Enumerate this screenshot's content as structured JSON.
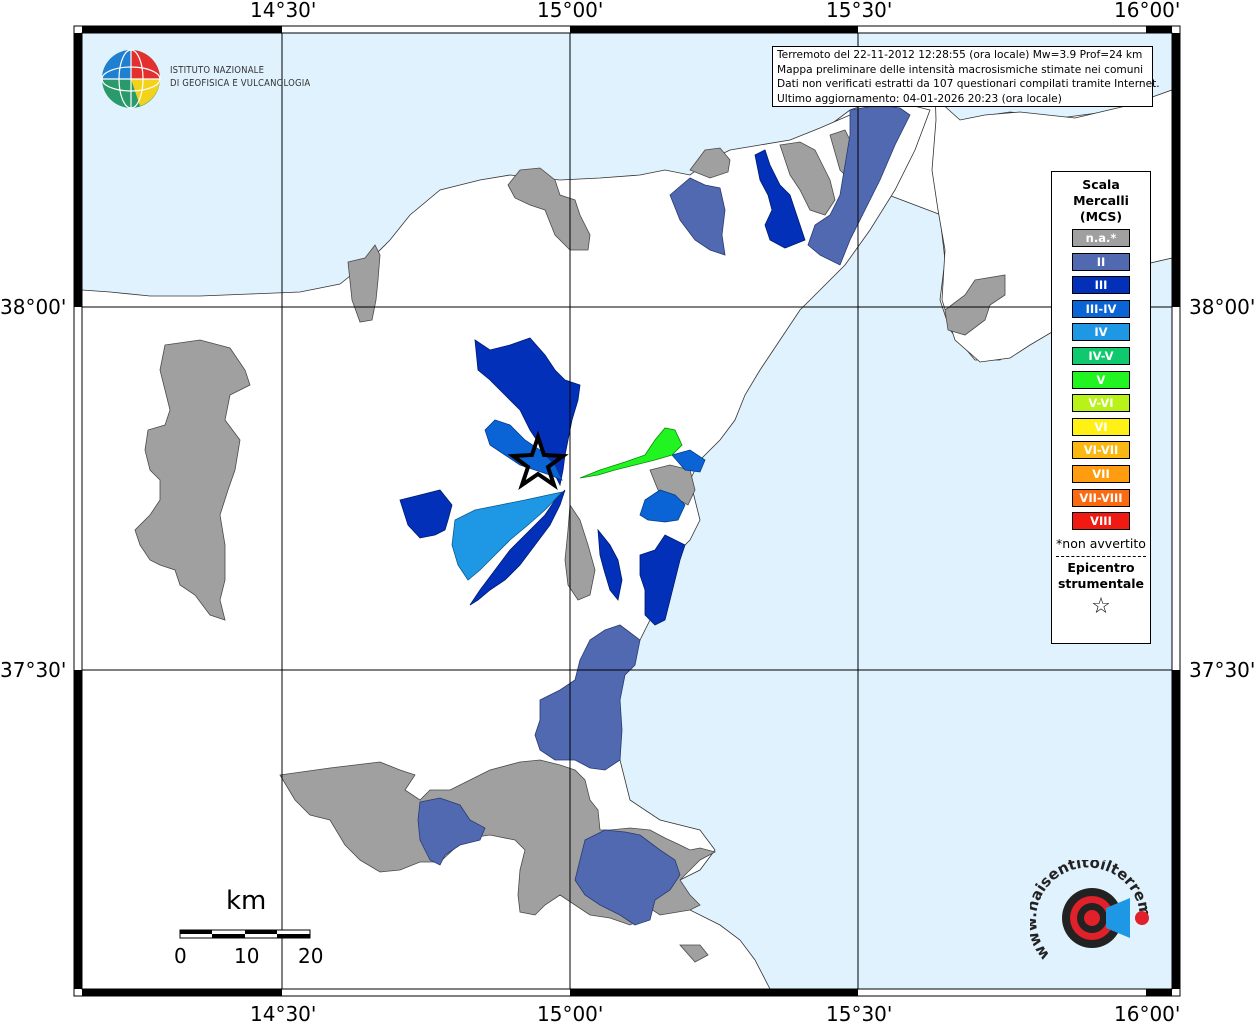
{
  "map": {
    "lon_labels": [
      "14°30'",
      "15°00'",
      "15°30'",
      "16°00'"
    ],
    "lat_labels": [
      "38°00'",
      "37°30'"
    ]
  },
  "header": {
    "lines": [
      "Terremoto del 22-11-2012 12:28:55 (ora locale) Mw=3.9 Prof=24 km",
      "Mappa preliminare delle intensità macrosismiche stimate nei comuni",
      "Dati non verificati estratti da 107 questionari compilati tramite Internet.",
      "Ultimo aggiornamento: 04-01-2026 20:23 (ora locale)"
    ]
  },
  "logo": {
    "line1": "ISTITUTO NAZIONALE",
    "line2": "DI GEOFISICA E VULCANOLOGIA"
  },
  "legend": {
    "title": "Scala\nMercalli\n(MCS)",
    "items": [
      {
        "label": "n.a.*",
        "color": "#a0a0a0"
      },
      {
        "label": "II",
        "color": "#5069b1"
      },
      {
        "label": "III",
        "color": "#0230b8"
      },
      {
        "label": "III-IV",
        "color": "#0a64d6"
      },
      {
        "label": "IV",
        "color": "#1e98e4"
      },
      {
        "label": "IV-V",
        "color": "#10c86e"
      },
      {
        "label": "V",
        "color": "#22f422"
      },
      {
        "label": "V-VI",
        "color": "#b8f218"
      },
      {
        "label": "VI",
        "color": "#fff016"
      },
      {
        "label": "VI-VII",
        "color": "#fcb812"
      },
      {
        "label": "VII",
        "color": "#ff9c10"
      },
      {
        "label": "VII-VIII",
        "color": "#fb6a10"
      },
      {
        "label": "VIII",
        "color": "#f01a12"
      }
    ],
    "note": "*non avvertito",
    "epicenter": "Epicentro\nstrumentale",
    "star": "☆"
  },
  "scale": {
    "unit": "km",
    "labels": [
      "0",
      "10",
      "20"
    ]
  },
  "hst_logo": {
    "text": "www.haisentitoilterremoto.it"
  },
  "colors": {
    "sea": "#e0f2fe",
    "land": "#ffffff",
    "grid": "#000000"
  }
}
